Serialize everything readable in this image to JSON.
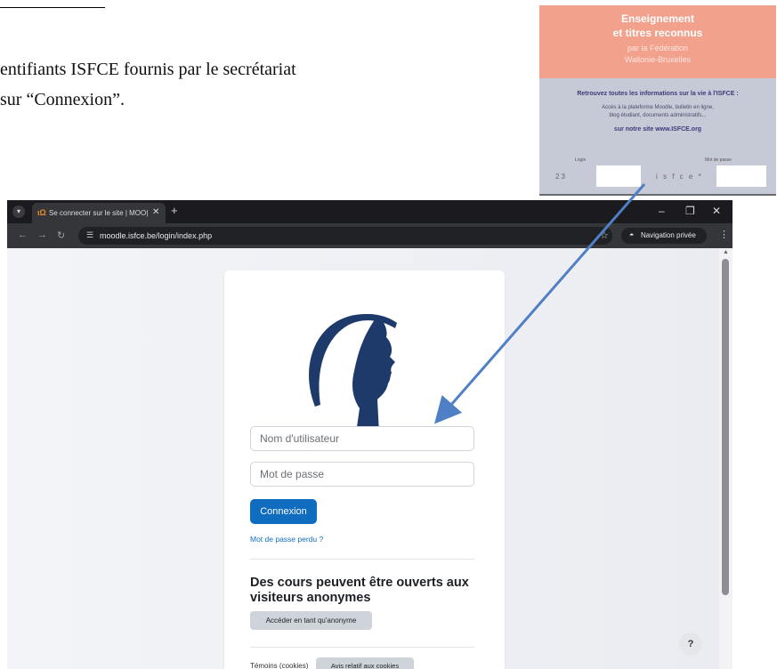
{
  "document": {
    "line1": "entifiants ISFCE fournis par le secrétariat",
    "line2": "sur “Connexion”."
  },
  "flyer": {
    "title_line1": "Enseignement",
    "title_line2": "et titres reconnus",
    "sub_line1": "par la Fédération",
    "sub_line2": "Wallonie-Bruxelles",
    "heading": "Retrouvez toutes les informations sur la vie à l'ISFCE :",
    "small_line1": "Accès à la plateforme Moodle, bulletin en ligne,",
    "small_line2": "blog étudiant, documents administratifs...",
    "site": "sur notre site www.ISFCE.org",
    "login_label": "Login",
    "password_label": "Mot de passe",
    "login_code": "23",
    "password_code": "i s f c e *"
  },
  "browser": {
    "tab_favicon": "ıΩ",
    "tab_title": "Se connecter sur le site | MOO|",
    "url": "moodle.isfce.be/login/index.php",
    "private_label": "Navigation privée"
  },
  "login": {
    "username_placeholder": "Nom d'utilisateur",
    "password_placeholder": "Mot de passe",
    "login_button": "Connexion",
    "forgot_link": "Mot de passe perdu ?",
    "guest_heading": "Des cours peuvent être ouverts aux visiteurs anonymes",
    "guest_button": "Accéder en tant qu'anonyme",
    "cookies_text": "Témoins (cookies)",
    "cookies_button": "Avis relatif aux cookies"
  },
  "help": {
    "label": "?"
  },
  "colors": {
    "primary": "#0f6cbf",
    "logo": "#1d3a6b",
    "arrow": "#4f7fc4",
    "flyer_accent": "#f2a18d"
  },
  "icons": [
    "menu-icon",
    "close-icon",
    "plus-icon",
    "minimize-icon",
    "restore-icon",
    "back-icon",
    "forward-icon",
    "reload-icon",
    "site-info-icon",
    "star-icon",
    "incognito-icon",
    "kebab-menu-icon",
    "help-icon"
  ]
}
